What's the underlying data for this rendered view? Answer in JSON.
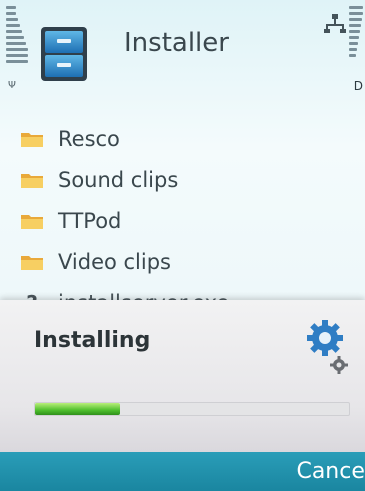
{
  "header": {
    "title": "Installer",
    "battery_label": "D",
    "icons": [
      "signal-strength-icon",
      "battery-level-icon",
      "installer-app-icon",
      "network-icon"
    ]
  },
  "file_list": {
    "items": [
      {
        "label": "Resco",
        "icon": "folder-icon"
      },
      {
        "label": "Sound clips",
        "icon": "folder-icon"
      },
      {
        "label": "TTPod",
        "icon": "folder-icon"
      },
      {
        "label": "Video clips",
        "icon": "folder-icon"
      },
      {
        "label": "installserver.exe",
        "icon": "unknown-file-icon",
        "glyph": "?"
      }
    ]
  },
  "dialog": {
    "title": "Installing",
    "progress": 0.27,
    "progress_color": "#4fbf2d",
    "icon": "gear-icon"
  },
  "softkeys": {
    "right_label": "Cancel",
    "bar_color": "#1a86a0"
  }
}
